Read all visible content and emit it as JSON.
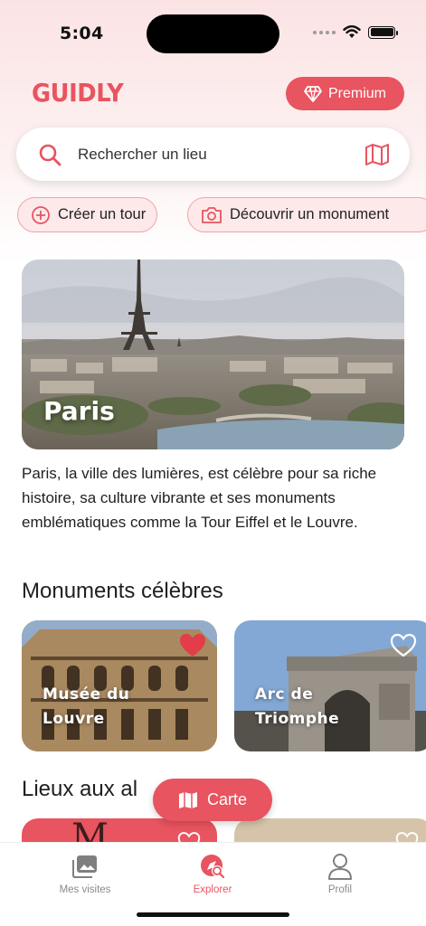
{
  "status": {
    "time": "5:04"
  },
  "header": {
    "logo": "GUIDLY",
    "premium_label": "Premium"
  },
  "search": {
    "placeholder": "Rechercher un lieu"
  },
  "chips": [
    {
      "label": "Créer un tour",
      "icon": "plus-circle-icon"
    },
    {
      "label": "Découvrir un monument",
      "icon": "camera-icon"
    }
  ],
  "hero": {
    "city": "Paris",
    "description": "Paris, la ville des lumières, est célèbre pour sa riche histoire, sa culture vibrante et ses monuments emblématiques comme la Tour Eiffel et le Louvre."
  },
  "monuments": {
    "title": "Monuments célèbres",
    "items": [
      {
        "name": "Musée du Louvre",
        "line1": "Musée du",
        "line2": "Louvre",
        "favorite": true
      },
      {
        "name": "Arc de Triomphe",
        "line1": "Arc de",
        "line2": "Triomphe",
        "favorite": false
      }
    ]
  },
  "places": {
    "title": "Lieux aux al"
  },
  "map_button": {
    "label": "Carte"
  },
  "tabbar": {
    "items": [
      {
        "label": "Mes visites",
        "icon": "gallery-icon",
        "active": false
      },
      {
        "label": "Explorer",
        "icon": "explore-icon",
        "active": true
      },
      {
        "label": "Profil",
        "icon": "user-icon",
        "active": false
      }
    ]
  },
  "colors": {
    "accent": "#e8545f",
    "chip_bg": "#fde9ea",
    "chip_border": "#efa3a8"
  }
}
